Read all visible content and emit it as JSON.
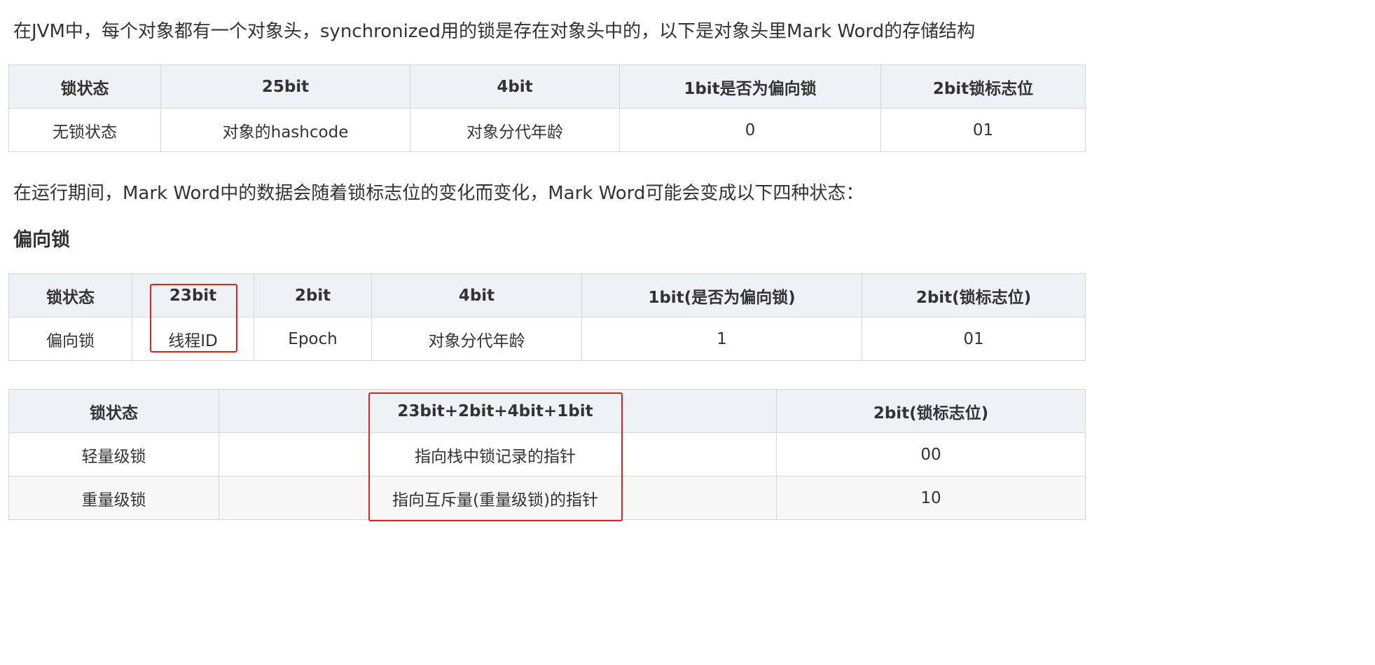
{
  "intro_text": "在JVM中，每个对象都有一个对象头，synchronized用的锁是存在对象头中的，以下是对象头里Mark Word的存储结构",
  "table1": {
    "headers": [
      "锁状态",
      "25bit",
      "4bit",
      "1bit是否为偏向锁",
      "2bit锁标志位"
    ],
    "rows": [
      [
        "无锁状态",
        "对象的hashcode",
        "对象分代年龄",
        "0",
        "01"
      ]
    ]
  },
  "runtime_text": "在运行期间，Mark Word中的数据会随着锁标志位的变化而变化，Mark Word可能会变成以下四种状态：",
  "biased_heading": "偏向锁",
  "table2": {
    "headers": [
      "锁状态",
      "23bit",
      "2bit",
      "4bit",
      "1bit(是否为偏向锁)",
      "2bit(锁标志位)"
    ],
    "rows": [
      [
        "偏向锁",
        "线程ID",
        "Epoch",
        "对象分代年龄",
        "1",
        "01"
      ]
    ]
  },
  "table3": {
    "headers": [
      "锁状态",
      "",
      "23bit+2bit+4bit+1bit",
      "",
      "2bit(锁标志位)"
    ],
    "rows": [
      [
        "轻量级锁",
        "",
        "指向栈中锁记录的指针",
        "",
        "00"
      ],
      [
        "重量级锁",
        "",
        "指向互斥量(重量级锁)的指针",
        "",
        "10"
      ]
    ]
  },
  "colors": {
    "header_bg": "#eff2f5",
    "border": "#d6d6d6",
    "highlight": "#e52222",
    "text": "#333333"
  }
}
